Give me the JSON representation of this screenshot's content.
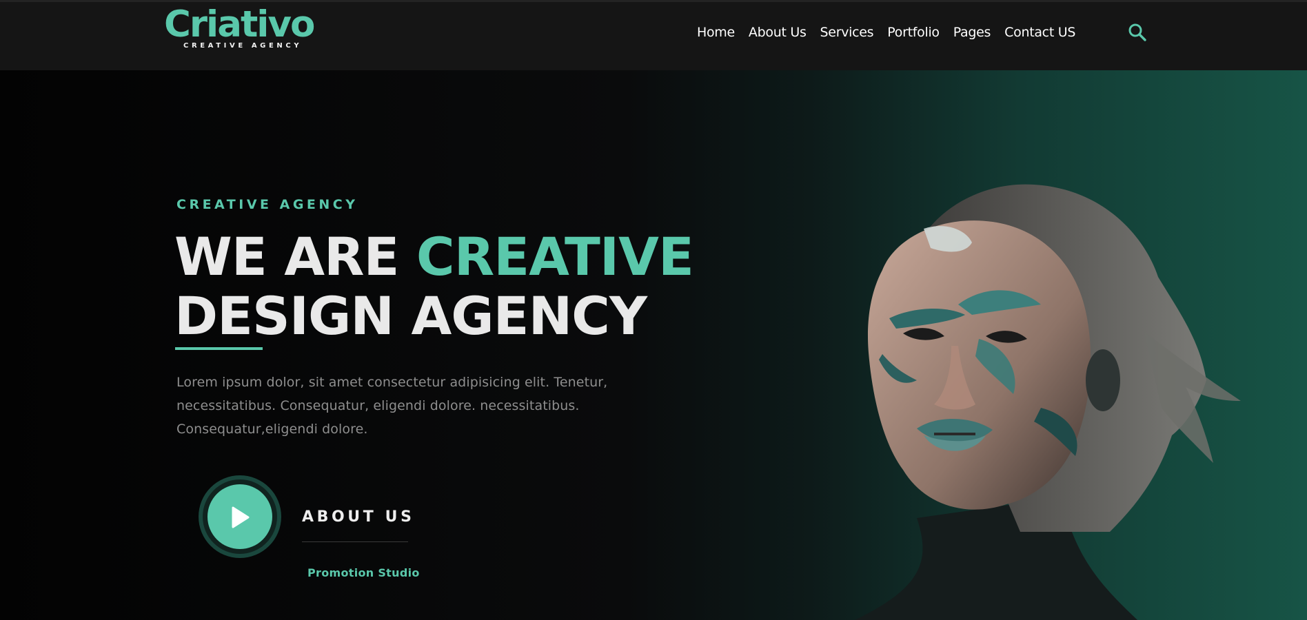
{
  "brand": {
    "name": "Criativo",
    "tagline": "CREATIVE AGENCY",
    "accent_color": "#5ac8ab"
  },
  "nav": {
    "items": [
      "Home",
      "About Us",
      "Services",
      "Portfolio",
      "Pages",
      "Contact US"
    ],
    "search_icon": "search-icon"
  },
  "hero": {
    "eyebrow": "CREATIVE AGENCY",
    "headline_part1": "WE ARE ",
    "headline_accent": "CREATIVE",
    "headline_line2": "DESIGN AGENCY",
    "description": "Lorem ipsum dolor, sit amet consectetur adipisicing elit. Tenetur, necessitatibus. Consequatur, eligendi dolore. necessitatibus. Consequatur,eligendi dolore.",
    "play_icon": "play-icon",
    "about_label": "ABOUT US",
    "promo_label": "Promotion Studio"
  }
}
